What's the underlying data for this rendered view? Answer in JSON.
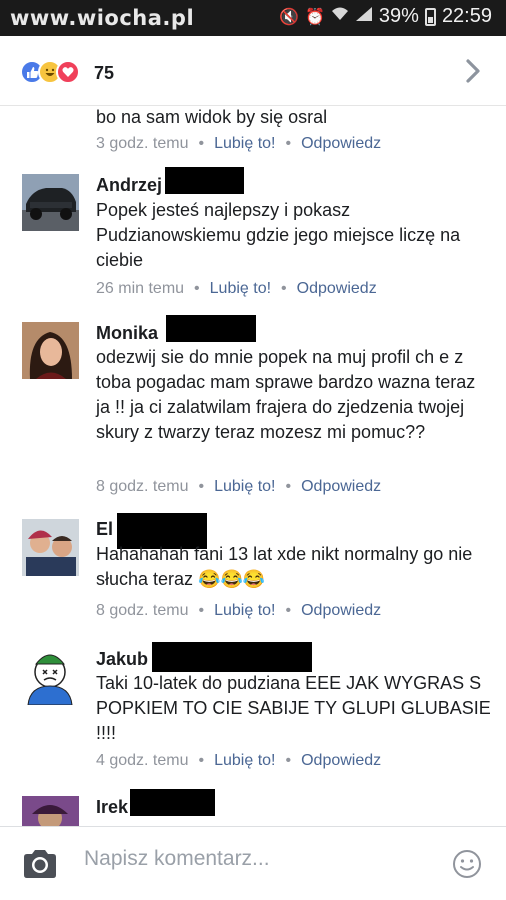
{
  "status_bar": {
    "watermark": "www.wiocha.pl",
    "battery": "39%",
    "time": "22:59",
    "icons": [
      "mute-icon",
      "alarm-icon",
      "wifi-icon",
      "signal-icon",
      "battery-icon"
    ]
  },
  "header": {
    "reaction_count": "75",
    "reactions": [
      "like",
      "haha",
      "love"
    ]
  },
  "comments": [
    {
      "name": "",
      "text": "bo na sam widok by się osral",
      "time": "3 godz. temu",
      "like": "Lubię to!",
      "reply": "Odpowiedz"
    },
    {
      "name": "Andrzej",
      "text": "Popek jesteś najlepszy i pokasz Pudzianowskiemu gdzie jego miejsce liczę na ciebie",
      "time": "26 min temu",
      "like": "Lubię to!",
      "reply": "Odpowiedz"
    },
    {
      "name": "Monika",
      "text": "odezwij sie do mnie popek na muj profil ch e z toba pogadac mam sprawe bardzo wazna teraz ja !! ja ci zalatwilam frajera do zjedzenia twojej skury z twarzy teraz mozesz mi pomuc??",
      "time": "8 godz. temu",
      "like": "Lubię to!",
      "reply": "Odpowiedz"
    },
    {
      "name": "El",
      "text": "Hahahahah fani 13 lat xde nikt normalny go nie słucha teraz 😂😂😂",
      "time": "8 godz. temu",
      "like": "Lubię to!",
      "reply": "Odpowiedz"
    },
    {
      "name": "Jakub",
      "text": "Taki 10-latek do pudziana EEE JAK WYGRAS S POPKIEM TO CIE SABIJE TY GLUPI GLUBASIE !!!!",
      "time": "4 godz. temu",
      "like": "Lubię to!",
      "reply": "Odpowiedz"
    },
    {
      "name": "Irek",
      "text": "",
      "time": "",
      "like": "",
      "reply": ""
    }
  ],
  "composer": {
    "placeholder": "Napisz komentarz..."
  },
  "colors": {
    "link": "#4b6794",
    "meta": "#90949c",
    "like_reaction": "#4a7ae8",
    "love_reaction": "#f0405a",
    "haha_reaction": "#f7c43f"
  }
}
